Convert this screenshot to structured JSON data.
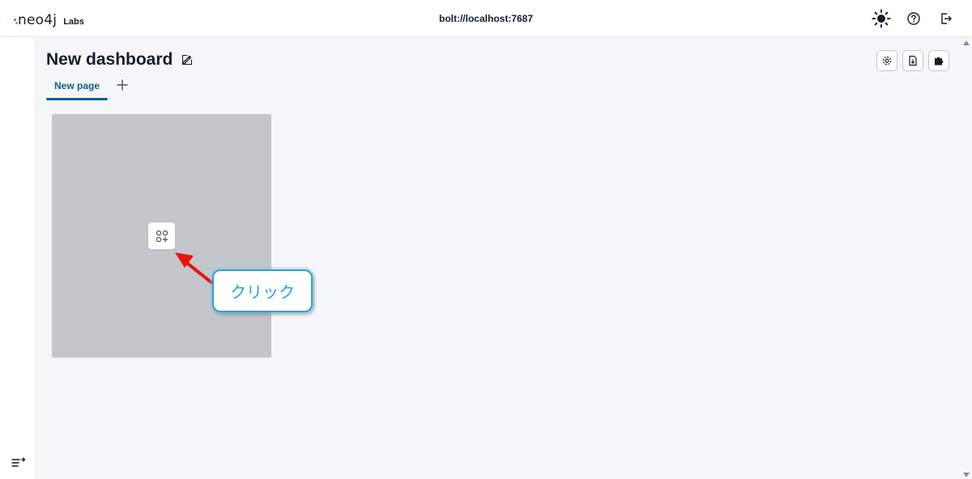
{
  "header": {
    "logo_text": "neo4j",
    "logo_suffix": "Labs",
    "connection": "bolt://localhost:7687",
    "icons": [
      "theme-toggle-sun-icon",
      "help-icon",
      "logout-icon"
    ]
  },
  "dashboard": {
    "title": "New dashboard",
    "actions": [
      "settings-icon",
      "export-icon",
      "extensions-icon"
    ]
  },
  "tabs": [
    {
      "label": "New page",
      "active": true
    }
  ],
  "card": {
    "add_icon": "add-report-icon"
  },
  "annotation": {
    "callout_text": "クリック"
  },
  "colors": {
    "accent": "#0a6190",
    "card_bg": "#c3c6cb",
    "callout_border": "#2aa4c9",
    "callout_text": "#1fa7d8",
    "arrow": "#e8120c"
  }
}
